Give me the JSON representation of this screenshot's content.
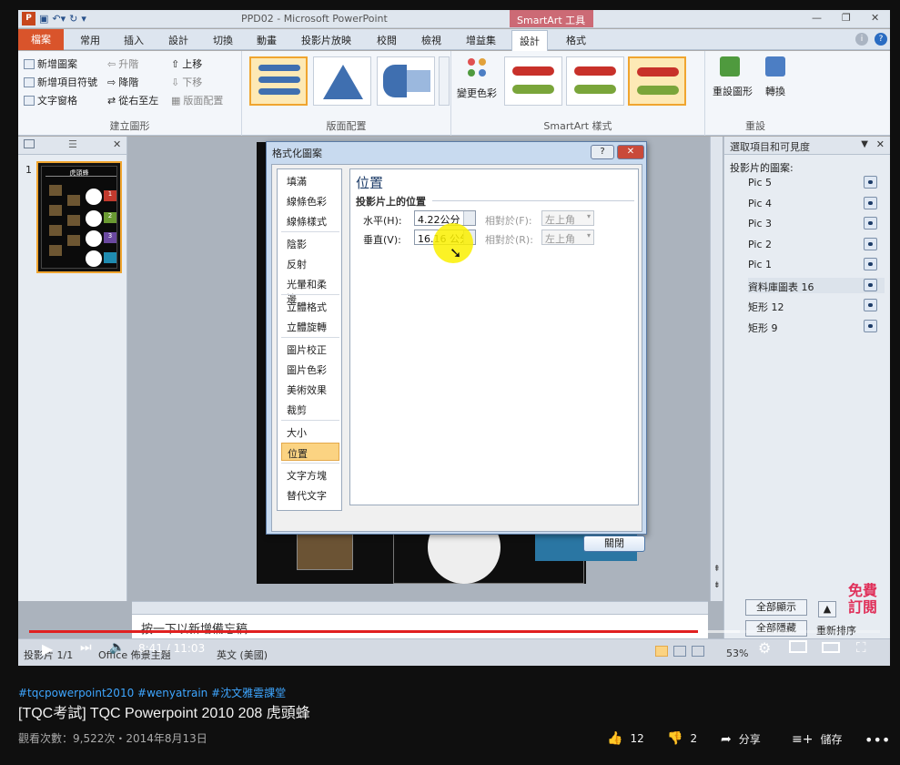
{
  "app": {
    "title": "PPD02 - Microsoft PowerPoint",
    "context_tab": "SmartArt 工具",
    "logo": "P"
  },
  "tabs": [
    "檔案",
    "常用",
    "插入",
    "設計",
    "切換",
    "動畫",
    "投影片放映",
    "校閱",
    "檢視",
    "增益集",
    "設計",
    "格式"
  ],
  "ribbon": {
    "create_graphic": {
      "label": "建立圖形",
      "items": [
        "新增圖案",
        "新增項目符號",
        "文字窗格",
        "升階",
        "降階",
        "從右至左",
        "上移",
        "下移",
        "版面配置"
      ]
    },
    "layouts": {
      "label": "版面配置"
    },
    "styles": {
      "label": "SmartArt 樣式",
      "change_colors": "變更色彩"
    },
    "reset": {
      "label": "重設",
      "reset_graphic": "重設圖形",
      "convert": "轉換"
    }
  },
  "thumb": {
    "slide_number": "1",
    "slide_title": "虎頭蜂",
    "labels": [
      "1",
      "2",
      "3"
    ]
  },
  "selection_pane": {
    "title": "選取項目和可見度",
    "section": "投影片的圖案:",
    "items": [
      "Pic 5",
      "Pic 4",
      "Pic 3",
      "Pic 2",
      "Pic 1",
      "資料庫圖表 16",
      "矩形 12",
      "矩形 9"
    ],
    "show_all": "全部顯示",
    "hide_all": "全部隱藏",
    "reorder": "重新排序"
  },
  "notes": {
    "placeholder": "按一下以新增備忘稿"
  },
  "status": {
    "slide": "投影片 1/1",
    "theme": "Office 佈景主題",
    "language": "英文 (美國)",
    "zoom": "53%"
  },
  "dialog": {
    "title": "格式化圖案",
    "help": "?",
    "close_x": "✕",
    "nav": [
      "填滿",
      "線條色彩",
      "線條樣式",
      "陰影",
      "反射",
      "光暈和柔邊",
      "立體格式",
      "立體旋轉",
      "圖片校正",
      "圖片色彩",
      "美術效果",
      "裁剪",
      "大小",
      "位置",
      "文字方塊",
      "替代文字"
    ],
    "selected": "位置",
    "section_title": "位置",
    "subsection": "投影片上的位置",
    "horizontal_label": "水平(H):",
    "horizontal_value": "4.22公分",
    "vertical_label": "垂直(V):",
    "vertical_value": "16.16 公分",
    "relative_h_label": "相對於(F):",
    "relative_h_value": "左上角",
    "relative_v_label": "相對於(R):",
    "relative_v_value": "左上角",
    "close_button": "關閉"
  },
  "player": {
    "time": "8:41 / 11:03",
    "progress": 0.786,
    "loaded": 0.835,
    "watermark": "免費訂閱"
  },
  "video": {
    "hashtags": "#tqcpowerpoint2010 #wenyatrain #沈文雅雲課堂",
    "title": "[TQC考試] TQC Powerpoint 2010 208 虎頭蜂",
    "meta": "觀看次數：9,522次・2014年8月13日",
    "likes": "12",
    "dislikes": "2",
    "share": "分享",
    "save": "儲存"
  },
  "colors": {
    "accent": "#d9542b",
    "progress": "#e02020",
    "link": "#3ea6ff"
  }
}
